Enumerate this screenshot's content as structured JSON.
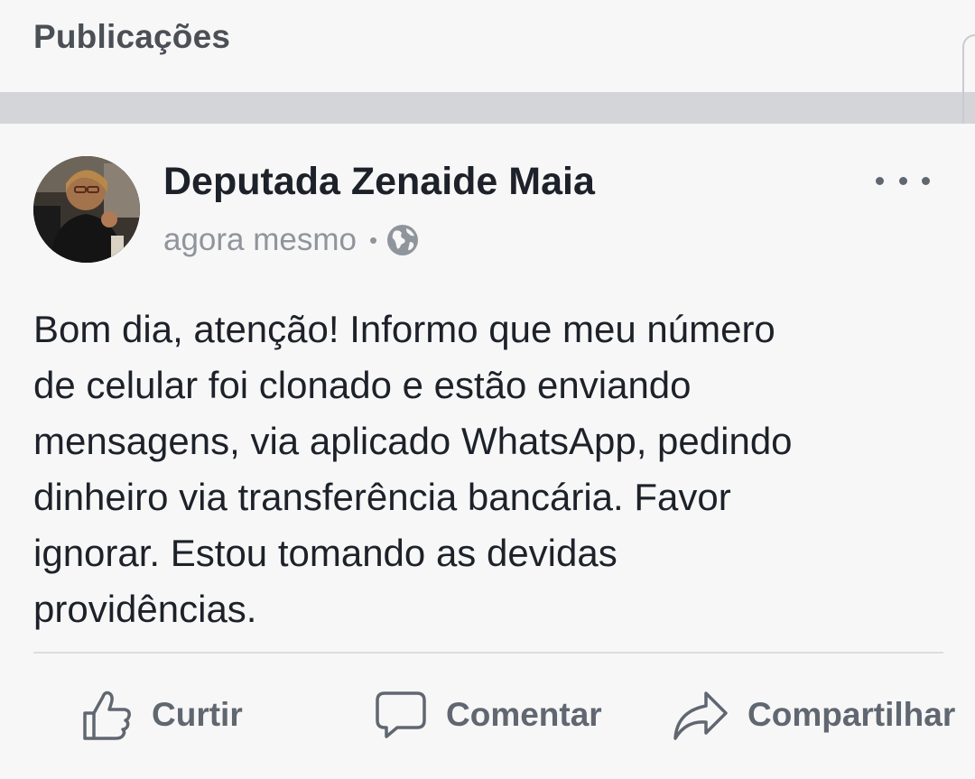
{
  "header": {
    "title": "Publicações"
  },
  "post": {
    "author": "Deputada Zenaide Maia",
    "timestamp": "agora mesmo",
    "separator": "•",
    "privacy_icon": "globe-icon",
    "menu_icon": "more-options-icon",
    "text": "Bom dia, atenção!  Informo que meu número\nde celular foi clonado e estão enviando\nmensagens, via aplicado WhatsApp, pedindo\ndinheiro via transferência bancária. Favor\nignorar. Estou tomando as devidas\nprovidências."
  },
  "actions": {
    "like_label": "Curtir",
    "comment_label": "Comentar",
    "share_label": "Compartilhar"
  },
  "colors": {
    "background": "#f7f7f7",
    "band": "#d3d5d9",
    "text": "#1d2129",
    "muted": "#90949c",
    "action": "#606770"
  }
}
